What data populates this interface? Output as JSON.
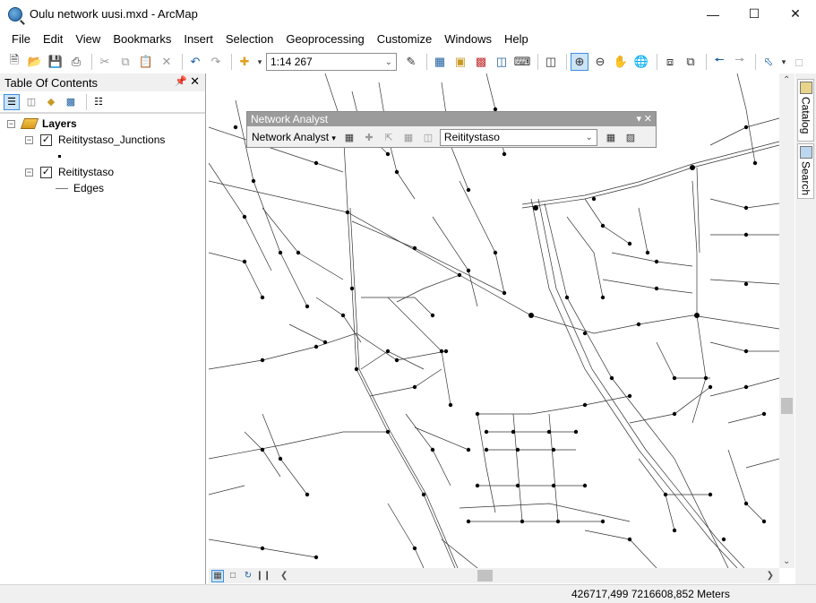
{
  "window": {
    "title": "Oulu network uusi.mxd - ArcMap",
    "controls": [
      "minimize",
      "maximize",
      "close"
    ]
  },
  "menu": [
    "File",
    "Edit",
    "View",
    "Bookmarks",
    "Insert",
    "Selection",
    "Geoprocessing",
    "Customize",
    "Windows",
    "Help"
  ],
  "toolbar": {
    "scale": "1:14 267",
    "icons": [
      "new-icon",
      "open-icon",
      "save-icon",
      "print-icon",
      "cut-icon",
      "copy-icon",
      "paste-icon",
      "delete-icon",
      "undo-icon",
      "redo-icon",
      "add-data-icon",
      "editor-icon",
      "table-icon",
      "catalog-icon",
      "arctoolbox-icon",
      "python-icon",
      "model-icon",
      "zoom-in-icon",
      "zoom-out-icon",
      "pan-icon",
      "full-extent-icon",
      "fixed-zoom-in-icon",
      "fixed-zoom-out-icon",
      "back-icon",
      "forward-icon",
      "select-icon",
      "clear-selection-icon"
    ]
  },
  "toc": {
    "title": "Table Of Contents",
    "root": "Layers",
    "layers": [
      {
        "name": "Reititystaso_Junctions",
        "checked": true,
        "legend": "point"
      },
      {
        "name": "Reititystaso",
        "checked": true,
        "legend": "Edges"
      }
    ]
  },
  "network_analyst": {
    "title": "Network Analyst",
    "menu_label": "Network Analyst",
    "layer_selected": "Reititystaso"
  },
  "side_tabs": [
    "Catalog",
    "Search"
  ],
  "status": {
    "coordinates": "426717,499  7216608,852 Meters"
  }
}
